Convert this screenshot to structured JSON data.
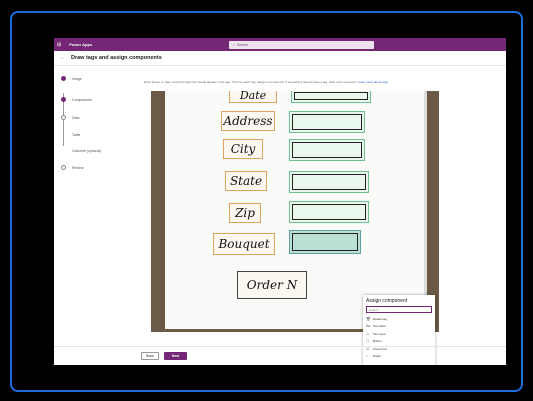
{
  "topbar": {
    "app_name": "Power Apps",
    "search_placeholder": "Search",
    "waffle": "⊞"
  },
  "header": {
    "back": "←",
    "title": "Draw tags and assign components"
  },
  "steps": [
    {
      "label": "Image",
      "state": "done"
    },
    {
      "label": "Components",
      "state": "done"
    },
    {
      "label": "Data",
      "state": "todo"
    },
    {
      "label": "Table",
      "state": "todo"
    },
    {
      "label": "Columns (optional)",
      "state": "todo"
    },
    {
      "label": "Review",
      "state": "todo"
    }
  ],
  "instructions": {
    "text": "Draw boxes, or tags, around things that should appear in the app. Then for each tag, assign a component. If something doesn't have a tag, draw a box around it.",
    "link": "Learn more about tags"
  },
  "photo_words": [
    "Date",
    "Address",
    "City",
    "State",
    "Zip",
    "Bouquet",
    "Order N"
  ],
  "popup": {
    "title": "Assign component",
    "search_placeholder": "Search",
    "options": [
      {
        "icon": "🗑",
        "label": "Delete tag"
      },
      {
        "icon": "Aa",
        "label": "Text label"
      },
      {
        "icon": "▭",
        "label": "Text input"
      },
      {
        "icon": "▢",
        "label": "Button"
      },
      {
        "icon": "☑",
        "label": "Check box"
      },
      {
        "icon": "○",
        "label": "Radio"
      }
    ]
  },
  "footer": {
    "back_label": "Back",
    "next_label": "Next"
  },
  "colors": {
    "brand": "#742774",
    "frame": "#1d6ddd",
    "tag_word": "#e0a35a",
    "tag_field": "#6fbf8f"
  }
}
